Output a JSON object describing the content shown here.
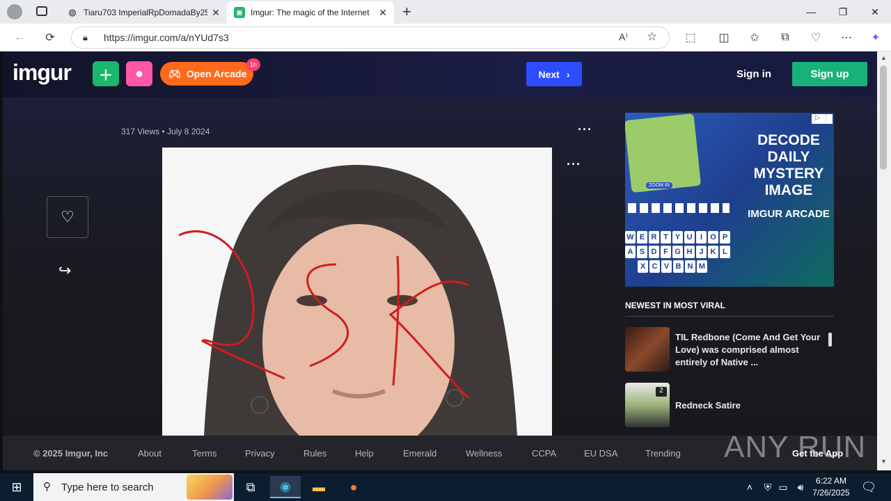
{
  "browser": {
    "tabs": [
      {
        "label": "Tiaru703 ImperialRpDomadaBy25",
        "icon": "globe-icon"
      },
      {
        "label": "Imgur: The magic of the Internet",
        "icon": "imgur-icon"
      }
    ],
    "url": "https://imgur.com/a/nYUd7s3"
  },
  "header": {
    "logo": "imgur",
    "arcade_label": "Open Arcade",
    "arcade_badge": "1h",
    "next_label": "Next",
    "signin_label": "Sign in",
    "signup_label": "Sign up"
  },
  "post": {
    "meta": "317 Views  •  July 8 2024"
  },
  "ad": {
    "headline": "DECODE DAILY MYSTERY IMAGE",
    "sub": "IMGUR ARCADE",
    "zoom": "ZOOM IN",
    "keys_row1": [
      "W",
      "E",
      "R",
      "T",
      "Y",
      "U",
      "I",
      "O",
      "P"
    ],
    "keys_row2": [
      "A",
      "S",
      "D",
      "F",
      "G",
      "H",
      "J",
      "K",
      "L"
    ],
    "keys_row3": [
      "X",
      "C",
      "V",
      "B",
      "N",
      "M"
    ]
  },
  "sidebar": {
    "newest_label": "NEWEST IN MOST VIRAL",
    "items": [
      {
        "title": "TIL Redbone (Come And Get Your Love) was comprised almost entirely of Native ..."
      },
      {
        "title": "Redneck Satire",
        "badge": "2"
      }
    ]
  },
  "footer": {
    "copyright": "© 2025 Imgur, Inc",
    "links": [
      "About",
      "Terms",
      "Privacy",
      "Rules",
      "Help",
      "Emerald",
      "Wellness",
      "CCPA",
      "EU DSA",
      "Trending"
    ],
    "app": "Get the App"
  },
  "watermark": "ANY RUN",
  "taskbar": {
    "search_placeholder": "Type here to search",
    "time": "6:22 AM",
    "date": "7/26/2025"
  }
}
